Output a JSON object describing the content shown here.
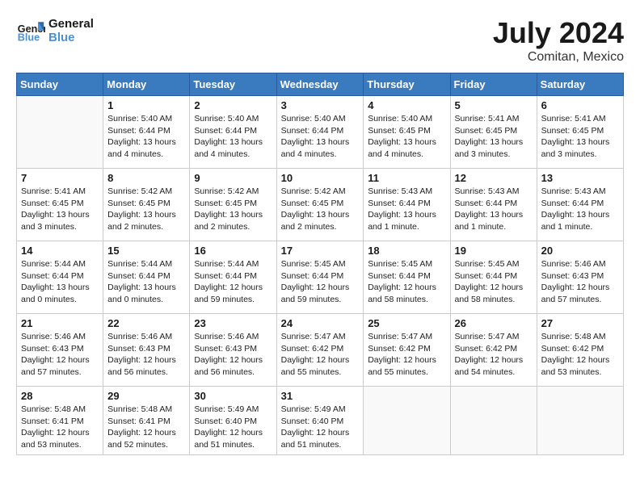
{
  "header": {
    "logo_general": "General",
    "logo_blue": "Blue",
    "month_title": "July 2024",
    "location": "Comitan, Mexico"
  },
  "days_of_week": [
    "Sunday",
    "Monday",
    "Tuesday",
    "Wednesday",
    "Thursday",
    "Friday",
    "Saturday"
  ],
  "weeks": [
    [
      {
        "day": "",
        "info": ""
      },
      {
        "day": "1",
        "info": "Sunrise: 5:40 AM\nSunset: 6:44 PM\nDaylight: 13 hours\nand 4 minutes."
      },
      {
        "day": "2",
        "info": "Sunrise: 5:40 AM\nSunset: 6:44 PM\nDaylight: 13 hours\nand 4 minutes."
      },
      {
        "day": "3",
        "info": "Sunrise: 5:40 AM\nSunset: 6:44 PM\nDaylight: 13 hours\nand 4 minutes."
      },
      {
        "day": "4",
        "info": "Sunrise: 5:40 AM\nSunset: 6:45 PM\nDaylight: 13 hours\nand 4 minutes."
      },
      {
        "day": "5",
        "info": "Sunrise: 5:41 AM\nSunset: 6:45 PM\nDaylight: 13 hours\nand 3 minutes."
      },
      {
        "day": "6",
        "info": "Sunrise: 5:41 AM\nSunset: 6:45 PM\nDaylight: 13 hours\nand 3 minutes."
      }
    ],
    [
      {
        "day": "7",
        "info": "Sunrise: 5:41 AM\nSunset: 6:45 PM\nDaylight: 13 hours\nand 3 minutes."
      },
      {
        "day": "8",
        "info": "Sunrise: 5:42 AM\nSunset: 6:45 PM\nDaylight: 13 hours\nand 2 minutes."
      },
      {
        "day": "9",
        "info": "Sunrise: 5:42 AM\nSunset: 6:45 PM\nDaylight: 13 hours\nand 2 minutes."
      },
      {
        "day": "10",
        "info": "Sunrise: 5:42 AM\nSunset: 6:45 PM\nDaylight: 13 hours\nand 2 minutes."
      },
      {
        "day": "11",
        "info": "Sunrise: 5:43 AM\nSunset: 6:44 PM\nDaylight: 13 hours\nand 1 minute."
      },
      {
        "day": "12",
        "info": "Sunrise: 5:43 AM\nSunset: 6:44 PM\nDaylight: 13 hours\nand 1 minute."
      },
      {
        "day": "13",
        "info": "Sunrise: 5:43 AM\nSunset: 6:44 PM\nDaylight: 13 hours\nand 1 minute."
      }
    ],
    [
      {
        "day": "14",
        "info": "Sunrise: 5:44 AM\nSunset: 6:44 PM\nDaylight: 13 hours\nand 0 minutes."
      },
      {
        "day": "15",
        "info": "Sunrise: 5:44 AM\nSunset: 6:44 PM\nDaylight: 13 hours\nand 0 minutes."
      },
      {
        "day": "16",
        "info": "Sunrise: 5:44 AM\nSunset: 6:44 PM\nDaylight: 12 hours\nand 59 minutes."
      },
      {
        "day": "17",
        "info": "Sunrise: 5:45 AM\nSunset: 6:44 PM\nDaylight: 12 hours\nand 59 minutes."
      },
      {
        "day": "18",
        "info": "Sunrise: 5:45 AM\nSunset: 6:44 PM\nDaylight: 12 hours\nand 58 minutes."
      },
      {
        "day": "19",
        "info": "Sunrise: 5:45 AM\nSunset: 6:44 PM\nDaylight: 12 hours\nand 58 minutes."
      },
      {
        "day": "20",
        "info": "Sunrise: 5:46 AM\nSunset: 6:43 PM\nDaylight: 12 hours\nand 57 minutes."
      }
    ],
    [
      {
        "day": "21",
        "info": "Sunrise: 5:46 AM\nSunset: 6:43 PM\nDaylight: 12 hours\nand 57 minutes."
      },
      {
        "day": "22",
        "info": "Sunrise: 5:46 AM\nSunset: 6:43 PM\nDaylight: 12 hours\nand 56 minutes."
      },
      {
        "day": "23",
        "info": "Sunrise: 5:46 AM\nSunset: 6:43 PM\nDaylight: 12 hours\nand 56 minutes."
      },
      {
        "day": "24",
        "info": "Sunrise: 5:47 AM\nSunset: 6:42 PM\nDaylight: 12 hours\nand 55 minutes."
      },
      {
        "day": "25",
        "info": "Sunrise: 5:47 AM\nSunset: 6:42 PM\nDaylight: 12 hours\nand 55 minutes."
      },
      {
        "day": "26",
        "info": "Sunrise: 5:47 AM\nSunset: 6:42 PM\nDaylight: 12 hours\nand 54 minutes."
      },
      {
        "day": "27",
        "info": "Sunrise: 5:48 AM\nSunset: 6:42 PM\nDaylight: 12 hours\nand 53 minutes."
      }
    ],
    [
      {
        "day": "28",
        "info": "Sunrise: 5:48 AM\nSunset: 6:41 PM\nDaylight: 12 hours\nand 53 minutes."
      },
      {
        "day": "29",
        "info": "Sunrise: 5:48 AM\nSunset: 6:41 PM\nDaylight: 12 hours\nand 52 minutes."
      },
      {
        "day": "30",
        "info": "Sunrise: 5:49 AM\nSunset: 6:40 PM\nDaylight: 12 hours\nand 51 minutes."
      },
      {
        "day": "31",
        "info": "Sunrise: 5:49 AM\nSunset: 6:40 PM\nDaylight: 12 hours\nand 51 minutes."
      },
      {
        "day": "",
        "info": ""
      },
      {
        "day": "",
        "info": ""
      },
      {
        "day": "",
        "info": ""
      }
    ]
  ]
}
